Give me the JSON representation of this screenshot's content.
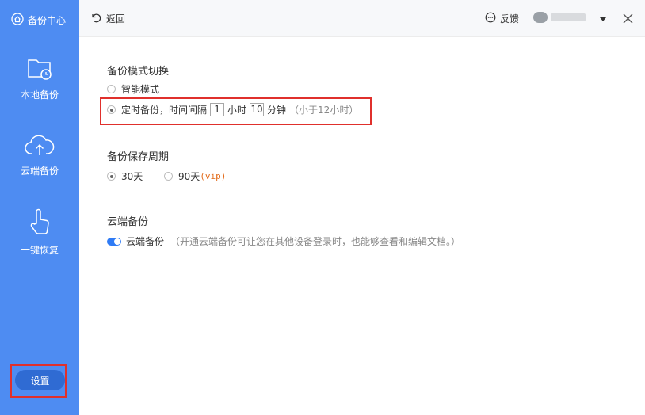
{
  "sidebar": {
    "brand": "备份中心",
    "items": [
      {
        "label": "本地备份",
        "icon": "folder-clock-icon"
      },
      {
        "label": "云端备份",
        "icon": "cloud-upload-icon"
      },
      {
        "label": "一键恢复",
        "icon": "hand-pointer-icon"
      }
    ],
    "settings_label": "设置"
  },
  "topbar": {
    "back_label": "返回",
    "feedback_label": "反馈"
  },
  "backup_mode": {
    "title": "备份模式切换",
    "smart_label": "智能模式",
    "timed_label": "定时备份，时间间隔",
    "hours_value": "1",
    "hours_unit": "小时",
    "minutes_value": "10",
    "minutes_unit": "分钟",
    "hint": "（小于12小时）",
    "selected": "timed"
  },
  "retention": {
    "title": "备份保存周期",
    "opt1": "30天",
    "opt2": "90天",
    "opt2_badge": "(vip)",
    "selected": "30天"
  },
  "cloud": {
    "title": "云端备份",
    "toggle_label": "云端备份",
    "toggle_on": true,
    "desc": "（开通云端备份可让您在其他设备登录时，也能够查看和编辑文档。）"
  },
  "colors": {
    "sidebar_bg": "#4e8cf2",
    "accent": "#2f7bf5",
    "highlight": "#e0302c",
    "vip": "#e36b1a"
  }
}
